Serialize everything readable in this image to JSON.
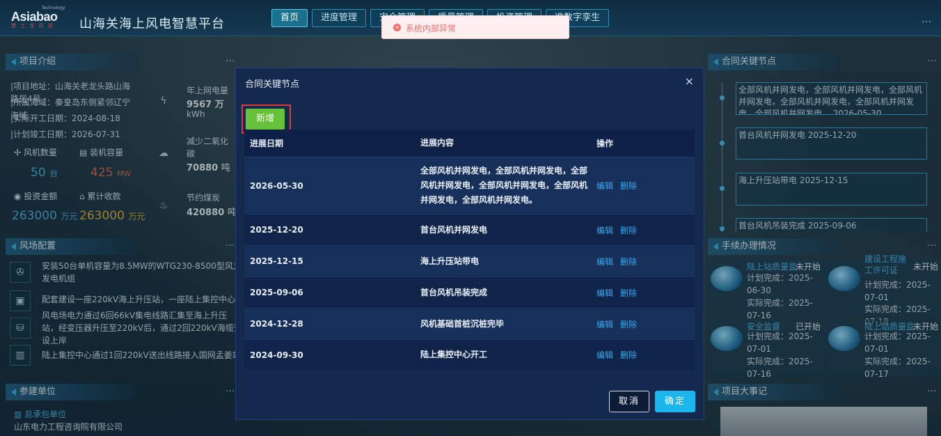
{
  "header": {
    "logo_small": "Technology",
    "logo_text": "Asiabao",
    "logo_sub": "慧 士 宝 科 技",
    "title": "山海关海上风电智慧平台",
    "nav": [
      {
        "label": "首页",
        "active": true
      },
      {
        "label": "进度管理",
        "active": false
      },
      {
        "label": "安全管理",
        "active": false
      },
      {
        "label": "质量管理",
        "active": false
      },
      {
        "label": "投资管理",
        "active": false
      },
      {
        "label": "准数字孪生",
        "active": false
      }
    ],
    "right_text": "…"
  },
  "toast": {
    "text": "系统内部异常"
  },
  "project_intro": {
    "title": "项目介绍",
    "address": "|项目地址：山海关老龙头路山海",
    "address2": "路居4号",
    "area": "|所属海域：秦皇岛东侧紧邻辽宁",
    "area2": "海域",
    "start": "|实际开工日期：2024-08-18",
    "finish": "|计划竣工日期：2026-07-31",
    "turbine_label": "风机数量",
    "turbine_val": "50",
    "turbine_unit": "台",
    "capacity_label": "装机容量",
    "capacity_val": "425",
    "capacity_unit": "MW",
    "invest_label": "投资金额",
    "invest_val": "263000",
    "invest_unit": "万元",
    "income_label": "累计收款",
    "income_val": "263000",
    "income_unit": "万元",
    "grid_label": "年上网电量",
    "grid_val": "9567",
    "grid_unit": "万",
    "grid_unit2": "kWh",
    "co2_label": "减少二氧化",
    "co2_label2": "碳",
    "co2_val": "70880",
    "co2_unit": "吨",
    "coal_label": "节约煤炭",
    "coal_val": "420880",
    "coal_unit": "吨"
  },
  "farm_config": {
    "title": "风场配置",
    "items": [
      "安装50台单机容量为8.5MW的WTG230-8500型风力",
      "发电机组",
      "配套建设一座220kV海上升压站，一座陆上集控中心",
      "风电场电力通过6回66kV集电线路汇集至海上升压",
      "站，经变压器升压至220kV后，通过2回220kV海缆登",
      "设上岸",
      "陆上集控中心通过1回220kV送出线路接入国网孟姜站"
    ]
  },
  "units": {
    "title": "参建单位",
    "sub": "总承包单位",
    "name": "山东电力工程咨询院有限公司"
  },
  "key_nodes": {
    "title": "合同关键节点",
    "items": [
      "全部风机并网发电，全部风机并网发电，全部风机并网发电，全部风机并网发电，全部风机并网发电，全部风机并网发电。 2026-05-30",
      "首台风机并网发电 2025-12-20",
      "海上升压站带电 2025-12-15",
      "首台风机吊装完成 2025-09-06"
    ]
  },
  "procedures": {
    "title": "手续办理情况",
    "items": [
      {
        "name": "陆上站质量监",
        "status": "未开始",
        "plan": "计划完成：2025-06-30",
        "actual": "实际完成：2025-07-16"
      },
      {
        "name": "建设工程施工许可证",
        "status": "未开始",
        "plan": "计划完成：2025-07-01",
        "actual": "实际完成：2025-07-18"
      },
      {
        "name": "安全监督",
        "status": "已开始",
        "plan": "计划完成：2025-07-01",
        "actual": "实际完成：2025-07-16"
      },
      {
        "name": "陆上站质量监",
        "status": "未开始",
        "plan": "计划完成：2025-07-01",
        "actual": "实际完成：2025-07-17"
      }
    ]
  },
  "events": {
    "title": "项目大事记"
  },
  "modal": {
    "title": "合同关键节点",
    "close": "×",
    "add_label": "新增",
    "headers": [
      "进展日期",
      "进展内容",
      "操作"
    ],
    "rows": [
      {
        "date": "2026-05-30",
        "content": "全部风机并网发电，全部风机并网发电，全部风机并网发电，全部风机并网发电，全部风机并网发电，全部风机并网发电。"
      },
      {
        "date": "2025-12-20",
        "content": "首台风机并网发电"
      },
      {
        "date": "2025-12-15",
        "content": "海上升压站带电"
      },
      {
        "date": "2025-09-06",
        "content": "首台风机吊装完成"
      },
      {
        "date": "2024-12-28",
        "content": "风机基础首桩沉桩完毕"
      },
      {
        "date": "2024-09-30",
        "content": "陆上集控中心开工"
      }
    ],
    "edit_label": "编辑",
    "delete_label": "删除",
    "cancel_label": "取消",
    "ok_label": "确定"
  }
}
